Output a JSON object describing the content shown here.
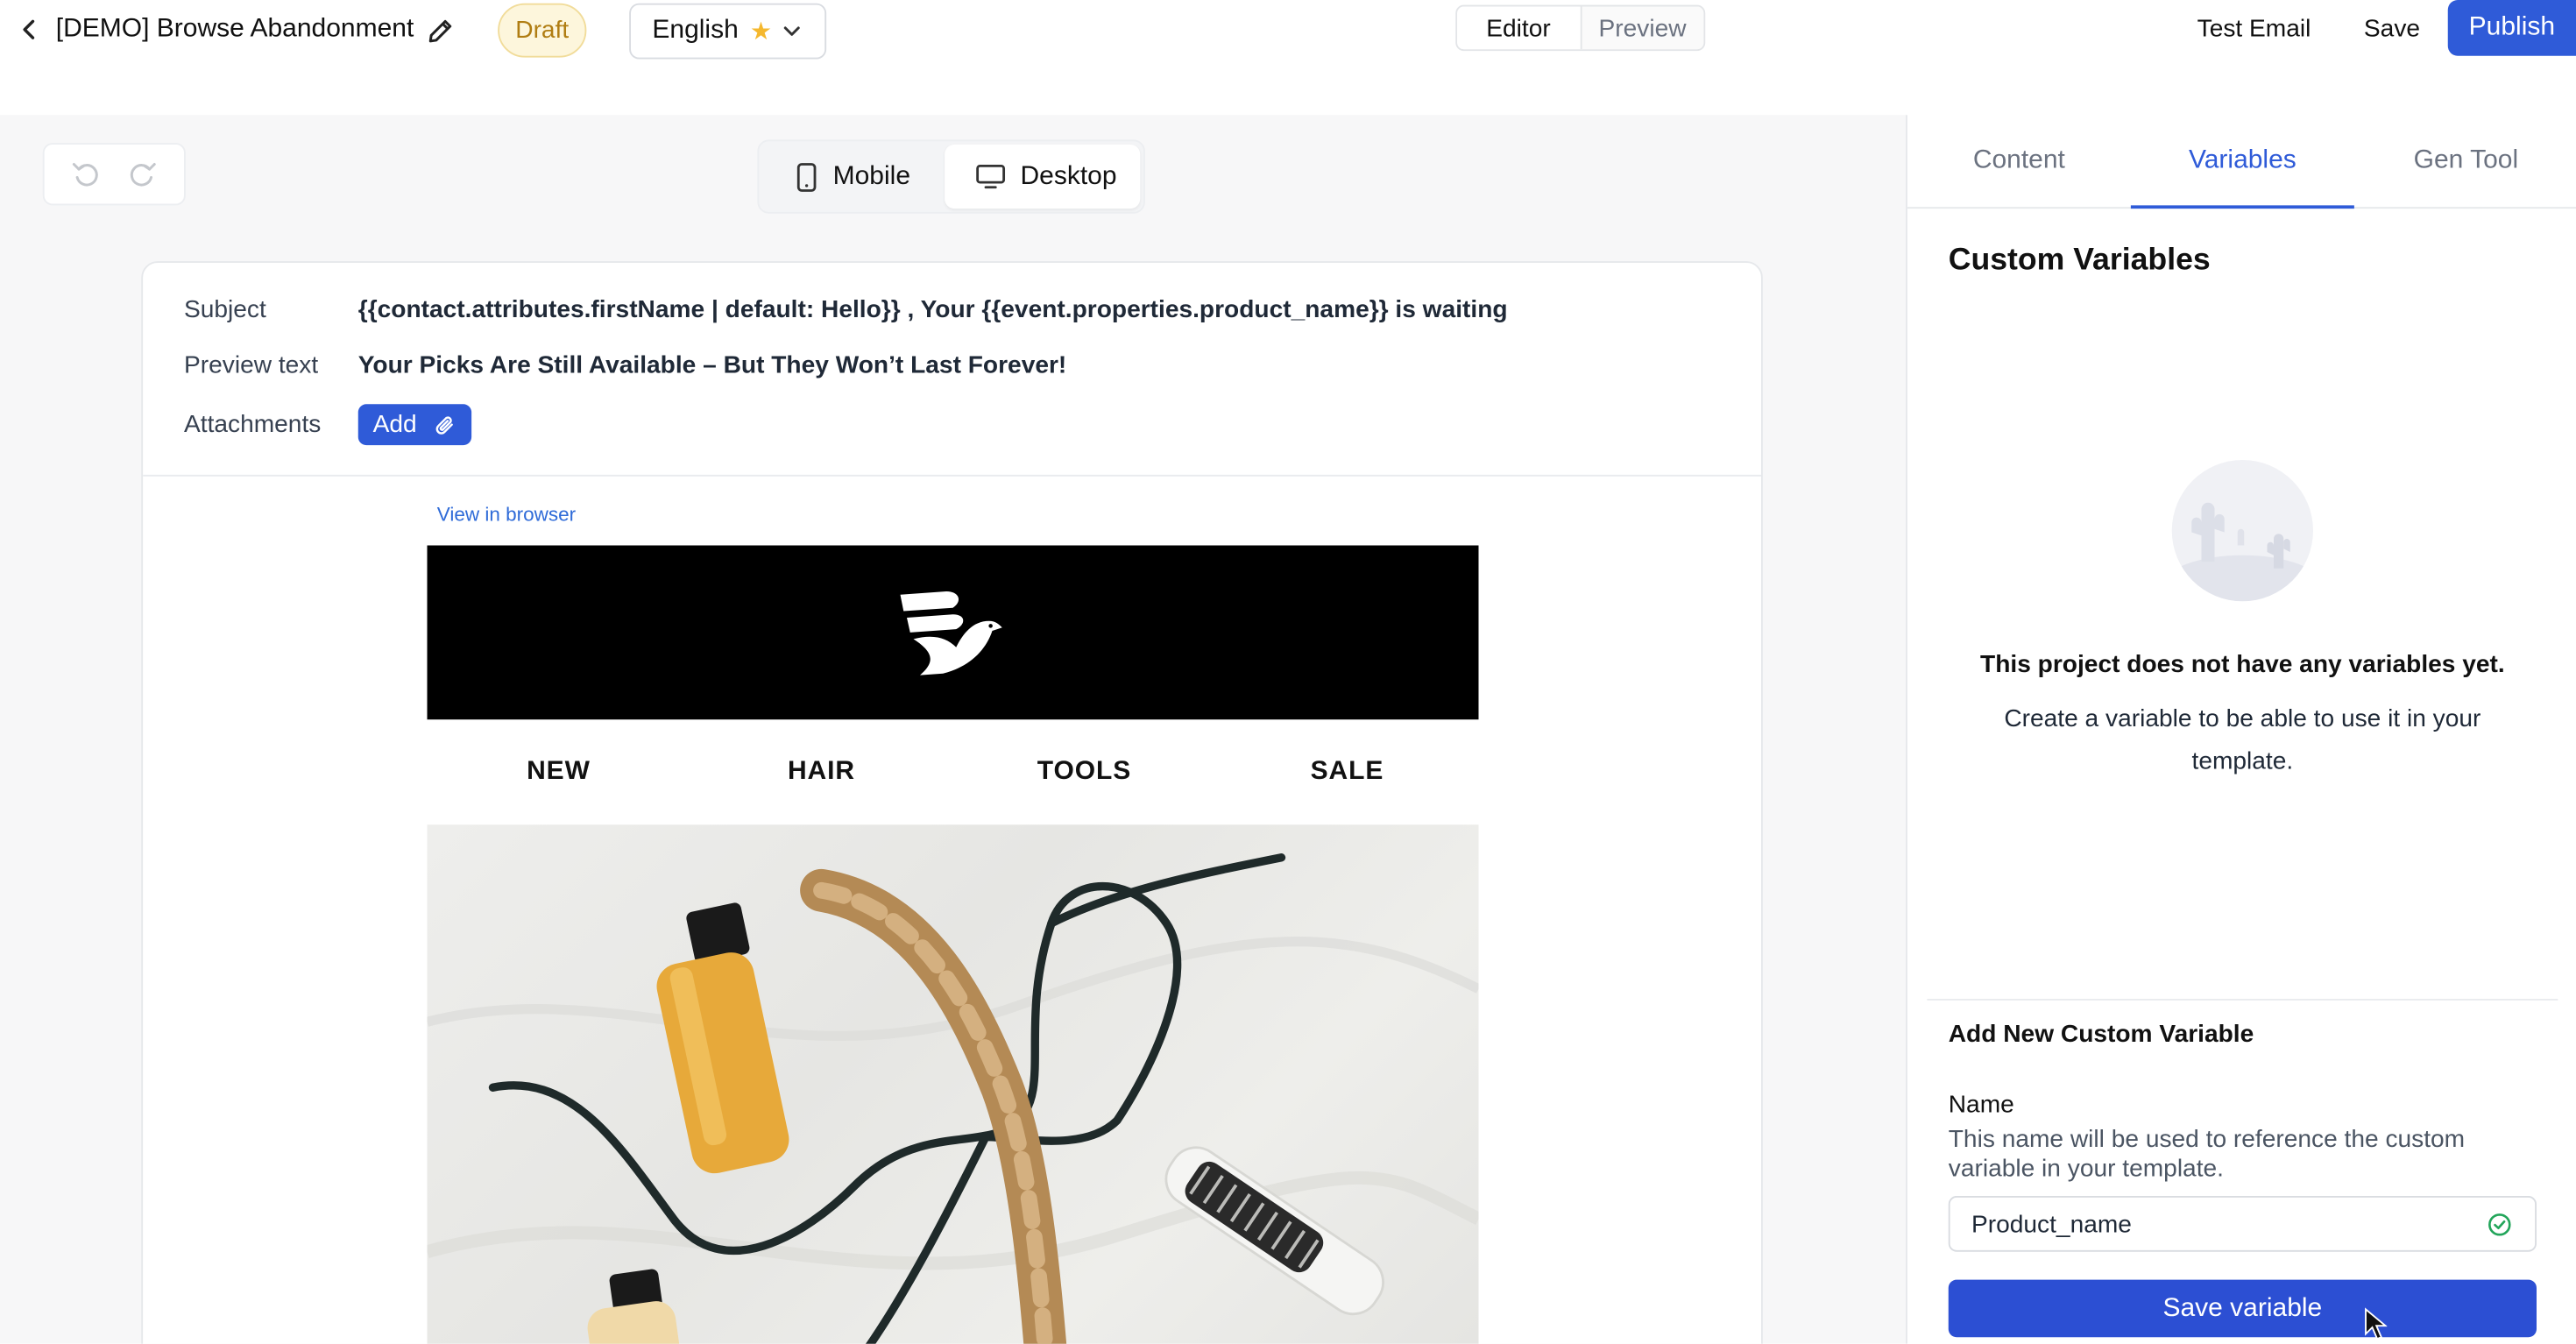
{
  "header": {
    "title": "[DEMO] Browse Abandonment",
    "status_badge": "Draft",
    "language": "English",
    "mode_tabs": [
      "Editor",
      "Preview"
    ],
    "test_email_label": "Test Email",
    "save_label": "Save",
    "publish_label": "Publish"
  },
  "toolbar": {
    "devices": [
      "Mobile",
      "Desktop"
    ],
    "active_device": "Desktop"
  },
  "email_meta": {
    "subject_label": "Subject",
    "subject_value": "{{contact.attributes.firstName | default: Hello}} , Your {{event.properties.product_name}} is waiting",
    "preview_label": "Preview text",
    "preview_value": "Your Picks Are Still Available – But They Won’t Last Forever!",
    "attachments_label": "Attachments",
    "add_label": "Add"
  },
  "email_body": {
    "view_in_browser": "View in browser",
    "nav": [
      "NEW",
      "HAIR",
      "TOOLS",
      "SALE"
    ]
  },
  "panel": {
    "tabs": [
      "Content",
      "Variables",
      "Gen Tool"
    ],
    "active_tab": "Variables",
    "title": "Custom Variables",
    "empty_title": "This project does not have any variables yet.",
    "empty_desc": "Create a variable to be able to use it in your template.",
    "add_title": "Add New Custom Variable",
    "name_label": "Name",
    "name_help": "This name will be used to reference the custom variable in your template.",
    "name_value": "Product_name",
    "save_variable_label": "Save variable"
  },
  "colors": {
    "accent": "#2f5bd8",
    "draft_bg": "#fdf6dc",
    "draft_text": "#b07d12",
    "success": "#22a55a"
  },
  "icons": [
    "chevron-left-icon",
    "pencil-icon",
    "star-icon",
    "chevron-down-icon",
    "undo-icon",
    "redo-icon",
    "mobile-icon",
    "desktop-icon",
    "paperclip-icon",
    "check-circle-icon",
    "cursor-icon"
  ]
}
